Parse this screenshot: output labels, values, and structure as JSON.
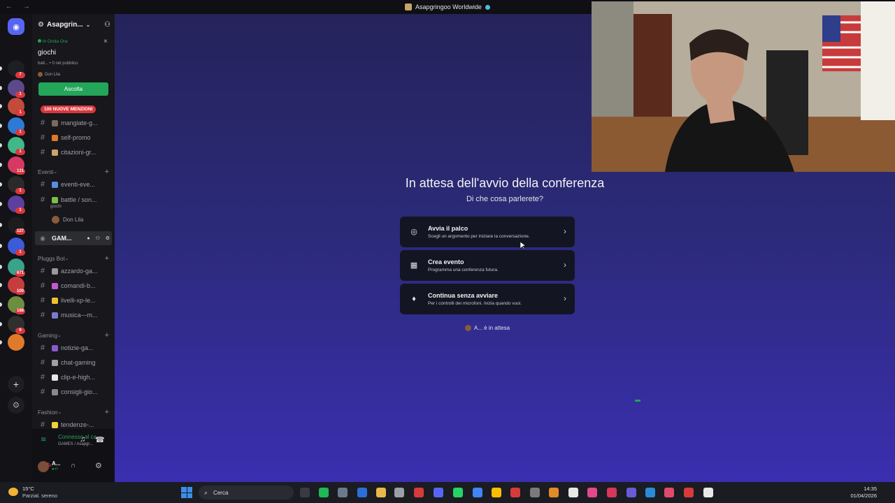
{
  "window": {
    "title": "Asapgringoo Worldwide"
  },
  "server_rail": {
    "badges": [
      "7",
      "1",
      "1",
      "1",
      "1",
      "131",
      "1",
      "1",
      "127",
      "1",
      "671",
      "100",
      "188",
      "6"
    ],
    "colors": [
      "#5865f2",
      "#1e1f22",
      "#5a4a8c",
      "#c24b3a",
      "#2d7ad6",
      "#3fb98a",
      "#d63964",
      "#2a2a2a",
      "#5d3fa0",
      "#1c1c1c",
      "#3b5bd9",
      "#39a38b",
      "#c63d3d",
      "#6b8e3f",
      "#2f2f2f",
      "#e07a2a"
    ]
  },
  "sidebar": {
    "server_name": "Asapgrin...",
    "live": {
      "status": "In Onda Ora",
      "title": "giochi",
      "meta": "batt... • 0 nel pubblico",
      "host": "Don Lila",
      "listen_button": "Ascolta"
    },
    "mentions_badge": "100 NUOVE MENZIONI",
    "channels_top": [
      "mangiate-g...",
      "self-promo",
      "citazioni-gr..."
    ],
    "categories": {
      "eventi": "Eventi",
      "pluggs": "Pluggs Bot",
      "gaming": "Gaming",
      "fashion": "Fashion"
    },
    "eventi_channels": [
      "eventi-eve...",
      "battle / son..."
    ],
    "eventi_sub": "giochi",
    "stage_user": "Don Lila",
    "stage_channel": "GAM...",
    "pluggs_channels": [
      "azzardo-ga...",
      "comandi-b...",
      "livelli-xp-le...",
      "musica---m..."
    ],
    "gaming_channels": [
      "notizie-ga...",
      "chat-gaming",
      "clip-e-high...",
      "consigli-gio..."
    ],
    "fashion_channels": [
      "tendenze-..."
    ],
    "voice": {
      "status": "Connesso al ca",
      "channel": "GAMES / Asapgr..."
    },
    "user": {
      "name": "A...",
      "tag": "●+!"
    }
  },
  "stage": {
    "title": "In attesa dell'avvio della conferenza",
    "subtitle": "Di che cosa parlerete?",
    "options": [
      {
        "title": "Avvia il palco",
        "desc": "Scegli un argomento per iniziare la conversazione."
      },
      {
        "title": "Crea evento",
        "desc": "Programma una conferenza futura."
      },
      {
        "title": "Continua senza avviare",
        "desc": "Per i controlli dei microfoni. Inizia quando vuoi."
      }
    ],
    "waiting": "A... è in attesa"
  },
  "taskbar": {
    "weather_temp": "15°C",
    "weather_desc": "Parzial. sereno",
    "search_placeholder": "Cerca",
    "time": "14:35",
    "date": "01/04/2026"
  }
}
